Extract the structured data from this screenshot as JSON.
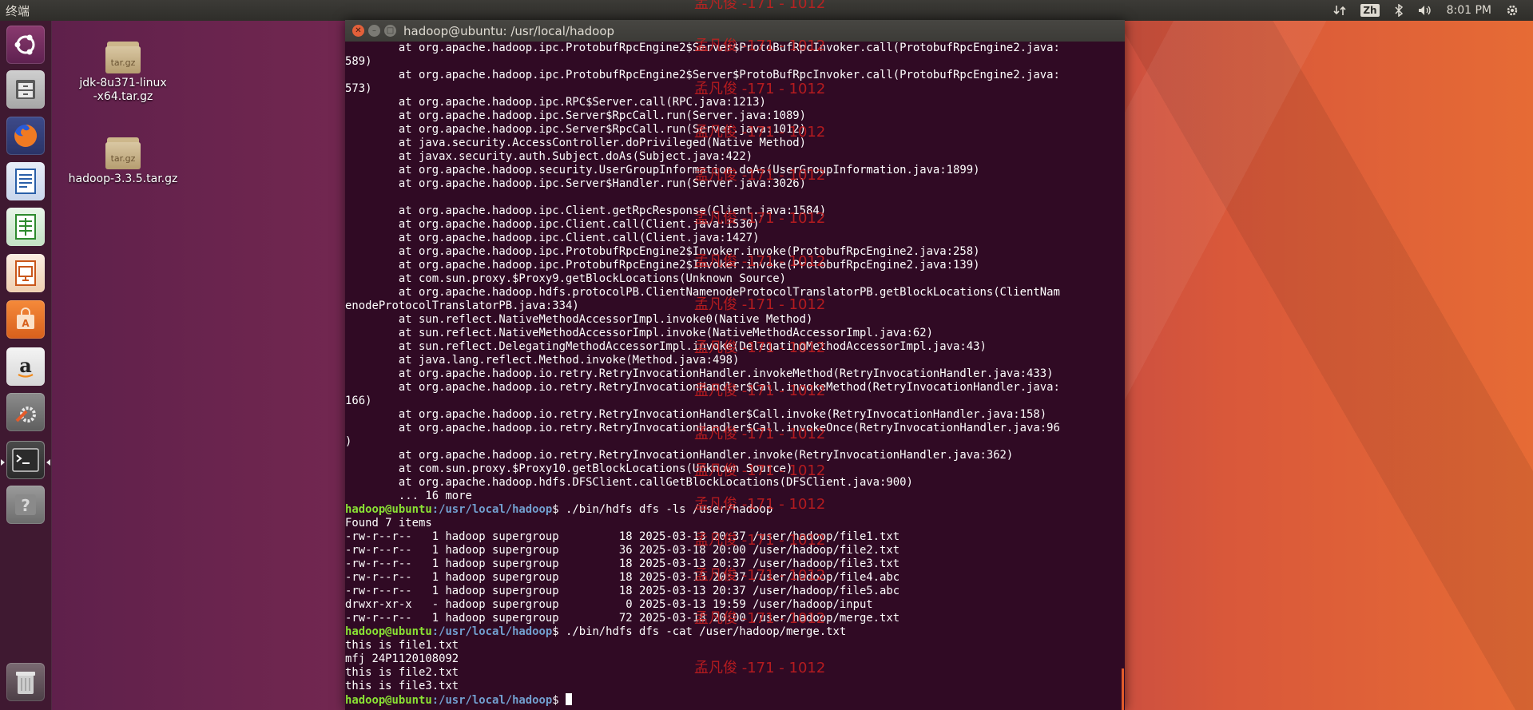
{
  "top_panel": {
    "app_name": "终端",
    "ime": "Zh",
    "clock": "8:01 PM"
  },
  "desktop": {
    "icons": [
      {
        "name": "jdk-8u371-linux-x64.tar.gz",
        "badge": "tar.gz"
      },
      {
        "name": "hadoop-3.3.5.tar.gz",
        "badge": "tar.gz"
      }
    ]
  },
  "launcher": {
    "items": [
      "ubuntu-dash",
      "files",
      "firefox",
      "libreoffice-writer",
      "libreoffice-calc",
      "libreoffice-impress",
      "software-center",
      "amazon",
      "system-settings",
      "terminal",
      "help",
      "trash"
    ]
  },
  "terminal": {
    "title": "hadoop@ubuntu: /usr/local/hadoop",
    "lines": [
      {
        "t": "        at org.apache.hadoop.ipc.ProtobufRpcEngine2$Server$ProtoBufRpcInvoker.call(ProtobufRpcEngine2.java:"
      },
      {
        "t": "589)"
      },
      {
        "t": "        at org.apache.hadoop.ipc.ProtobufRpcEngine2$Server$ProtoBufRpcInvoker.call(ProtobufRpcEngine2.java:"
      },
      {
        "t": "573)"
      },
      {
        "t": "        at org.apache.hadoop.ipc.RPC$Server.call(RPC.java:1213)"
      },
      {
        "t": "        at org.apache.hadoop.ipc.Server$RpcCall.run(Server.java:1089)"
      },
      {
        "t": "        at org.apache.hadoop.ipc.Server$RpcCall.run(Server.java:1012)"
      },
      {
        "t": "        at java.security.AccessController.doPrivileged(Native Method)"
      },
      {
        "t": "        at javax.security.auth.Subject.doAs(Subject.java:422)"
      },
      {
        "t": "        at org.apache.hadoop.security.UserGroupInformation.doAs(UserGroupInformation.java:1899)"
      },
      {
        "t": "        at org.apache.hadoop.ipc.Server$Handler.run(Server.java:3026)"
      },
      {
        "t": ""
      },
      {
        "t": "        at org.apache.hadoop.ipc.Client.getRpcResponse(Client.java:1584)"
      },
      {
        "t": "        at org.apache.hadoop.ipc.Client.call(Client.java:1530)"
      },
      {
        "t": "        at org.apache.hadoop.ipc.Client.call(Client.java:1427)"
      },
      {
        "t": "        at org.apache.hadoop.ipc.ProtobufRpcEngine2$Invoker.invoke(ProtobufRpcEngine2.java:258)"
      },
      {
        "t": "        at org.apache.hadoop.ipc.ProtobufRpcEngine2$Invoker.invoke(ProtobufRpcEngine2.java:139)"
      },
      {
        "t": "        at com.sun.proxy.$Proxy9.getBlockLocations(Unknown Source)"
      },
      {
        "t": "        at org.apache.hadoop.hdfs.protocolPB.ClientNamenodeProtocolTranslatorPB.getBlockLocations(ClientNam"
      },
      {
        "t": "enodeProtocolTranslatorPB.java:334)"
      },
      {
        "t": "        at sun.reflect.NativeMethodAccessorImpl.invoke0(Native Method)"
      },
      {
        "t": "        at sun.reflect.NativeMethodAccessorImpl.invoke(NativeMethodAccessorImpl.java:62)"
      },
      {
        "t": "        at sun.reflect.DelegatingMethodAccessorImpl.invoke(DelegatingMethodAccessorImpl.java:43)"
      },
      {
        "t": "        at java.lang.reflect.Method.invoke(Method.java:498)"
      },
      {
        "t": "        at org.apache.hadoop.io.retry.RetryInvocationHandler.invokeMethod(RetryInvocationHandler.java:433)"
      },
      {
        "t": "        at org.apache.hadoop.io.retry.RetryInvocationHandler$Call.invokeMethod(RetryInvocationHandler.java:"
      },
      {
        "t": "166)"
      },
      {
        "t": "        at org.apache.hadoop.io.retry.RetryInvocationHandler$Call.invoke(RetryInvocationHandler.java:158)"
      },
      {
        "t": "        at org.apache.hadoop.io.retry.RetryInvocationHandler$Call.invokeOnce(RetryInvocationHandler.java:96"
      },
      {
        "t": ")"
      },
      {
        "t": "        at org.apache.hadoop.io.retry.RetryInvocationHandler.invoke(RetryInvocationHandler.java:362)"
      },
      {
        "t": "        at com.sun.proxy.$Proxy10.getBlockLocations(Unknown Source)"
      },
      {
        "t": "        at org.apache.hadoop.hdfs.DFSClient.callGetBlockLocations(DFSClient.java:900)"
      },
      {
        "t": "        ... 16 more"
      },
      {
        "u": "hadoop@ubuntu",
        "p": ":/usr/local/hadoop",
        "c": "$ ./bin/hdfs dfs -ls /user/hadoop"
      },
      {
        "t": "Found 7 items"
      },
      {
        "t": "-rw-r--r--   1 hadoop supergroup         18 2025-03-13 20:37 /user/hadoop/file1.txt"
      },
      {
        "t": "-rw-r--r--   1 hadoop supergroup         36 2025-03-18 20:00 /user/hadoop/file2.txt"
      },
      {
        "t": "-rw-r--r--   1 hadoop supergroup         18 2025-03-13 20:37 /user/hadoop/file3.txt"
      },
      {
        "t": "-rw-r--r--   1 hadoop supergroup         18 2025-03-13 20:37 /user/hadoop/file4.abc"
      },
      {
        "t": "-rw-r--r--   1 hadoop supergroup         18 2025-03-13 20:37 /user/hadoop/file5.abc"
      },
      {
        "t": "drwxr-xr-x   - hadoop supergroup          0 2025-03-13 19:59 /user/hadoop/input"
      },
      {
        "t": "-rw-r--r--   1 hadoop supergroup         72 2025-03-18 20:00 /user/hadoop/merge.txt"
      },
      {
        "u": "hadoop@ubuntu",
        "p": ":/usr/local/hadoop",
        "c": "$ ./bin/hdfs dfs -cat /user/hadoop/merge.txt"
      },
      {
        "t": "this is file1.txt"
      },
      {
        "t": "mfj 24P1120108092"
      },
      {
        "t": "this is file2.txt"
      },
      {
        "t": "this is file3.txt"
      },
      {
        "u": "hadoop@ubuntu",
        "p": ":/usr/local/hadoop",
        "c": "$ ",
        "cursor": true
      }
    ]
  },
  "watermark": {
    "text": "孟凡俊 -171 - 1012",
    "color": "#cc1f1f"
  }
}
